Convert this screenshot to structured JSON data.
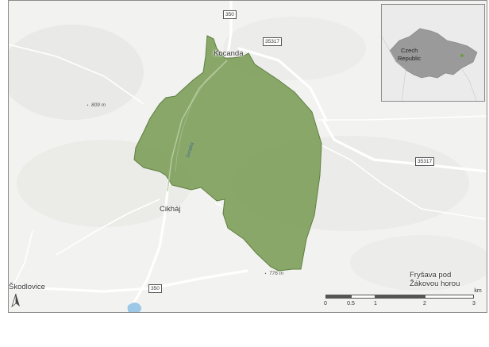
{
  "colors": {
    "reserve_fill": "#7d9f5a",
    "reserve_stroke": "#5f7f3f",
    "road": "#ffffff",
    "background": "#f2f2f0",
    "water": "#9cc7e6",
    "inset_country": "#9a9a9a",
    "inset_point": "#6f9a45"
  },
  "places": {
    "kocanda": "Kocanda",
    "cikhaj": "Cikháj",
    "skodlovice": "Škodlovice",
    "frysava_line1": "Fryšava pod",
    "frysava_line2": "Žákovou horou"
  },
  "roads": {
    "road_350_top": "350",
    "road_35317_top": "35317",
    "road_35317_right": "35317",
    "road_350_bottom": "350"
  },
  "elevations": {
    "elev_809": "809 m",
    "elev_776": "776 m"
  },
  "stream": "Svratka",
  "inset": {
    "country_line1": "Czech",
    "country_line2": "Republic"
  },
  "scalebar": {
    "unit": "km",
    "labels": [
      "0",
      "0.5",
      "1",
      "2",
      "3"
    ]
  },
  "icons": {
    "north_arrow": "north-arrow-icon",
    "location_point": "location-dot-icon"
  }
}
